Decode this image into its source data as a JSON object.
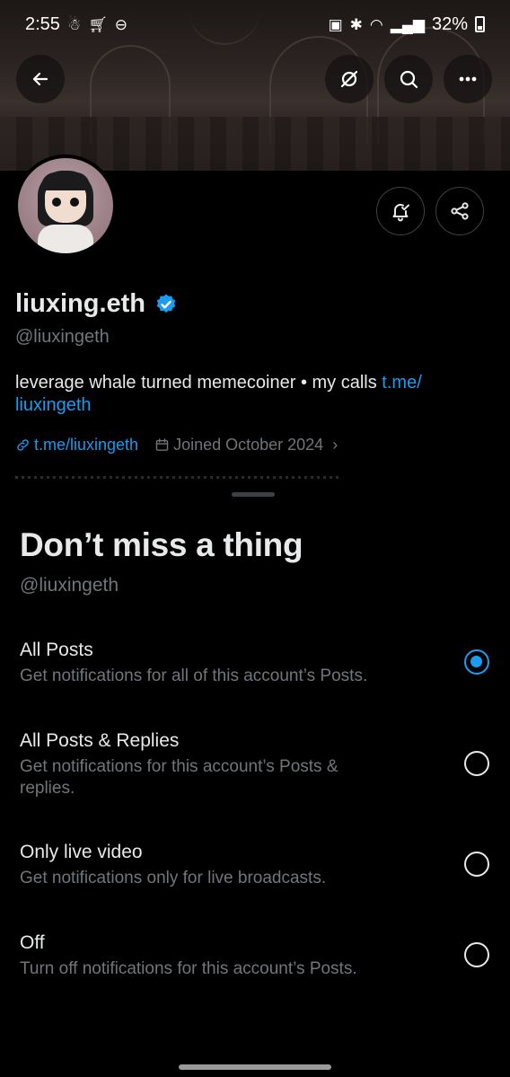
{
  "status_bar": {
    "time": "2:55",
    "battery": "32%"
  },
  "profile": {
    "name": "liuxing.eth",
    "handle": "@liuxingeth",
    "bio_text": "leverage whale turned memecoiner • my calls ",
    "bio_link_1": "t.me/",
    "bio_link_2": "liuxingeth",
    "link": "t.me/liuxingeth",
    "joined": "Joined October 2024",
    "verified_color": "#1d9bf0"
  },
  "sheet": {
    "title": "Don’t miss a thing",
    "subtitle": "@liuxingeth",
    "options": [
      {
        "title": "All Posts",
        "desc": "Get notifications for all of this account’s Posts.",
        "selected": true
      },
      {
        "title": "All Posts & Replies",
        "desc": "Get notifications for this account’s Posts & replies.",
        "selected": false
      },
      {
        "title": "Only live video",
        "desc": "Get notifications only for live broadcasts.",
        "selected": false
      },
      {
        "title": "Off",
        "desc": "Turn off notifications for this account’s Posts.",
        "selected": false
      }
    ]
  },
  "colors": {
    "accent": "#1d9bf0",
    "secondary_text": "#71767b",
    "primary_text": "#e7e9ea"
  }
}
